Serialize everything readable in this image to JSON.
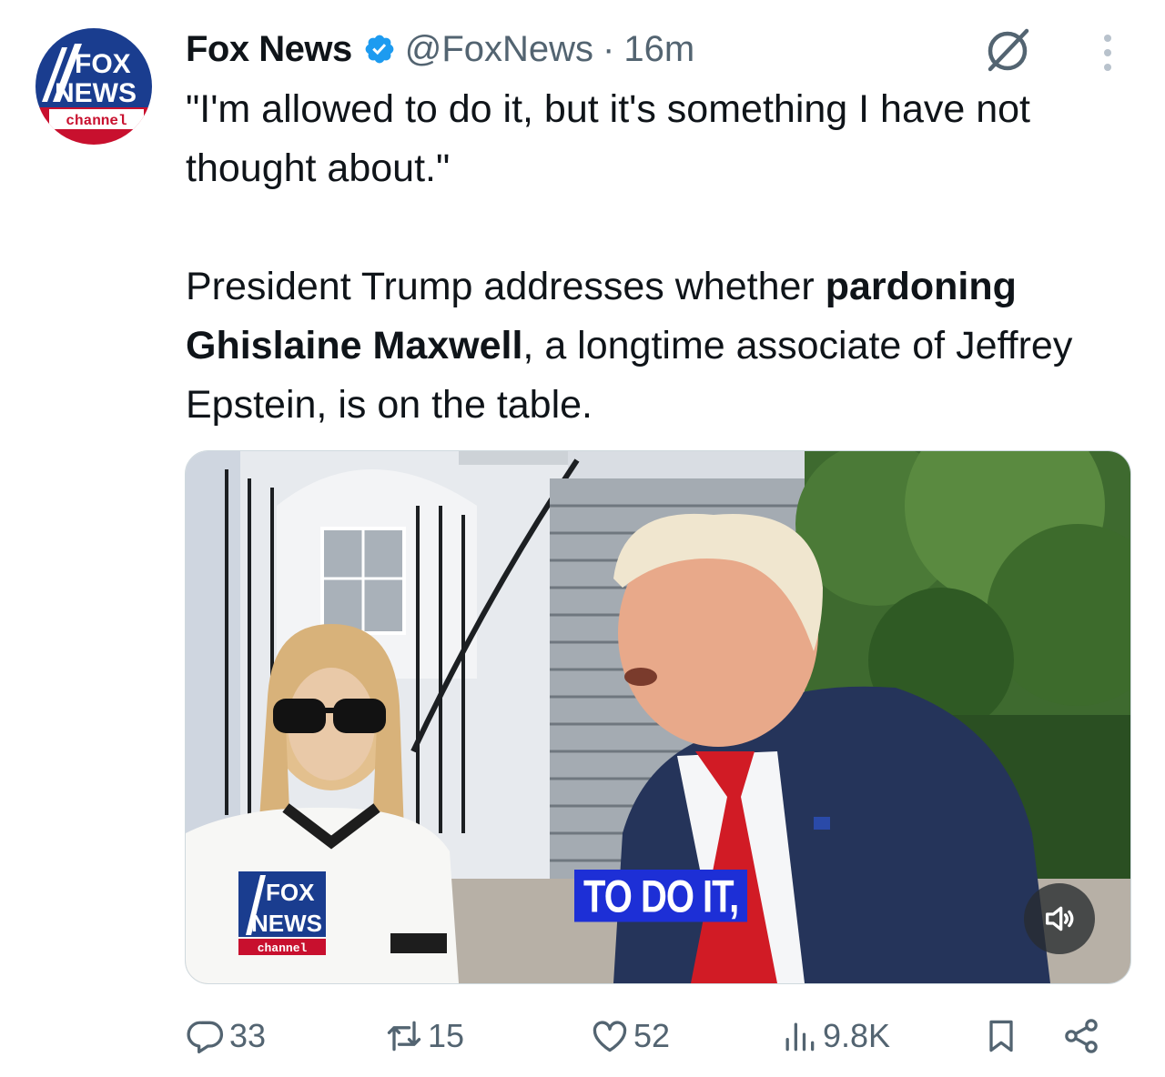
{
  "author": {
    "display_name": "Fox News",
    "handle": "@FoxNews",
    "separator": "·",
    "time": "16m",
    "avatar_logo": {
      "line1": "FOX",
      "line2": "NEWS",
      "line3": "channel"
    }
  },
  "tweet": {
    "quote": "\"I'm allowed to do it, but it's something I have not thought about.\"",
    "body_before": "President Trump addresses whether ",
    "body_bold": "pardoning Ghislaine Maxwell",
    "body_after": ", a longtime associate of Jeffrey Epstein, is on the table."
  },
  "media": {
    "caption": "TO DO IT,",
    "bug": {
      "line1": "FOX",
      "line2": "NEWS",
      "line3": "channel"
    }
  },
  "actions": {
    "replies": "33",
    "reposts": "15",
    "likes": "52",
    "views": "9.8K"
  },
  "colors": {
    "text": "#0f1419",
    "secondary": "#536471",
    "verified": "#1d9bf0",
    "caption_bg": "#1d2fd6",
    "fox_blue": "#1a3d8f",
    "fox_red": "#c8102e"
  },
  "icons": [
    "verified-badge-icon",
    "grok-icon",
    "more-icon",
    "reply-icon",
    "repost-icon",
    "like-icon",
    "views-icon",
    "bookmark-icon",
    "share-icon",
    "volume-icon"
  ]
}
